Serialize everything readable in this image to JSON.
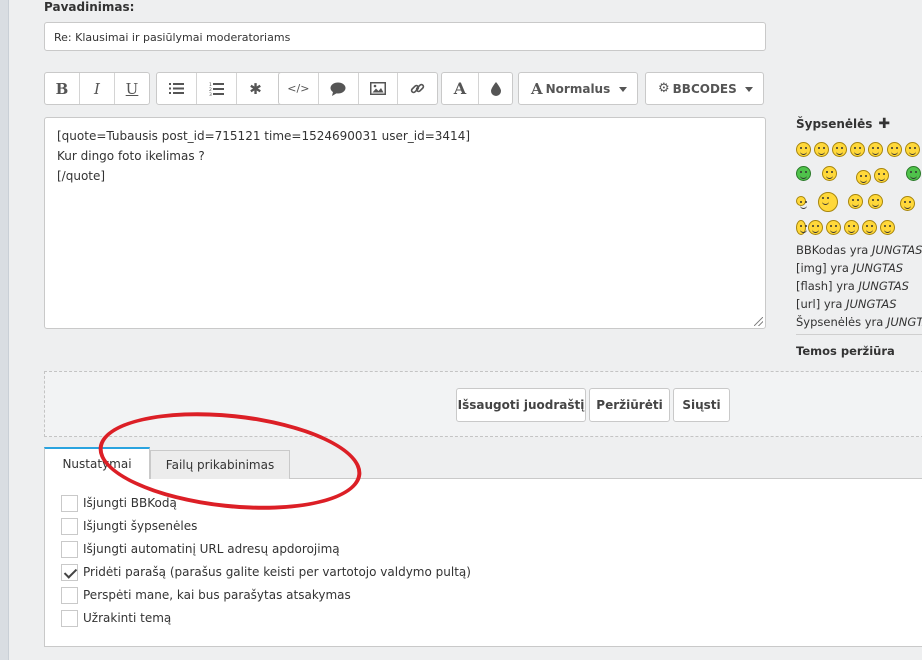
{
  "form": {
    "subject_label": "Pavadinimas:",
    "subject_value": "Re: Klausimai ir pasiūlymai moderatoriams"
  },
  "toolbar": {
    "font_size_label": "Normalus",
    "bbcodes_label": "BBCODES"
  },
  "editor": {
    "lines": [
      "[quote=Tubausis post_id=715121 time=1524690031 user_id=3414]",
      "Kur dingo foto ikelimas ?",
      "[/quote]"
    ]
  },
  "sidebar": {
    "smilies_title": "Šypsenėlės",
    "bbinfo": [
      {
        "label": "BBKodas yra",
        "status": "JUNGTAS"
      },
      {
        "label": "[img] yra",
        "status": "JUNGTAS"
      },
      {
        "label": "[flash] yra",
        "status": "JUNGTAS"
      },
      {
        "label": "[url] yra",
        "status": "JUNGTAS"
      },
      {
        "label": "Šypsenėlės yra",
        "status": "JUNGTAS"
      }
    ],
    "preview_label": "Temos peržiūra"
  },
  "actions": {
    "save_draft": "Išsaugoti juodraštį",
    "preview": "Peržiūrėti",
    "submit": "Siųsti"
  },
  "tabs": [
    {
      "label": "Nustatymai"
    },
    {
      "label": "Failų prikabinimas"
    }
  ],
  "options": [
    {
      "label": "Išjungti BBKodą",
      "checked": false
    },
    {
      "label": "Išjungti šypsenėles",
      "checked": false
    },
    {
      "label": "Išjungti automatinį URL adresų apdorojimą",
      "checked": false
    },
    {
      "label": "Pridėti parašą (parašus galite keisti per vartotojo valdymo pultą)",
      "checked": true
    },
    {
      "label": "Perspėti mane, kai bus parašytas atsakymas",
      "checked": false
    },
    {
      "label": "Užrakinti temą",
      "checked": false
    }
  ],
  "colors": {
    "active_tab_accent": "#2aa3df",
    "annotation_ellipse": "#dc1f26"
  }
}
